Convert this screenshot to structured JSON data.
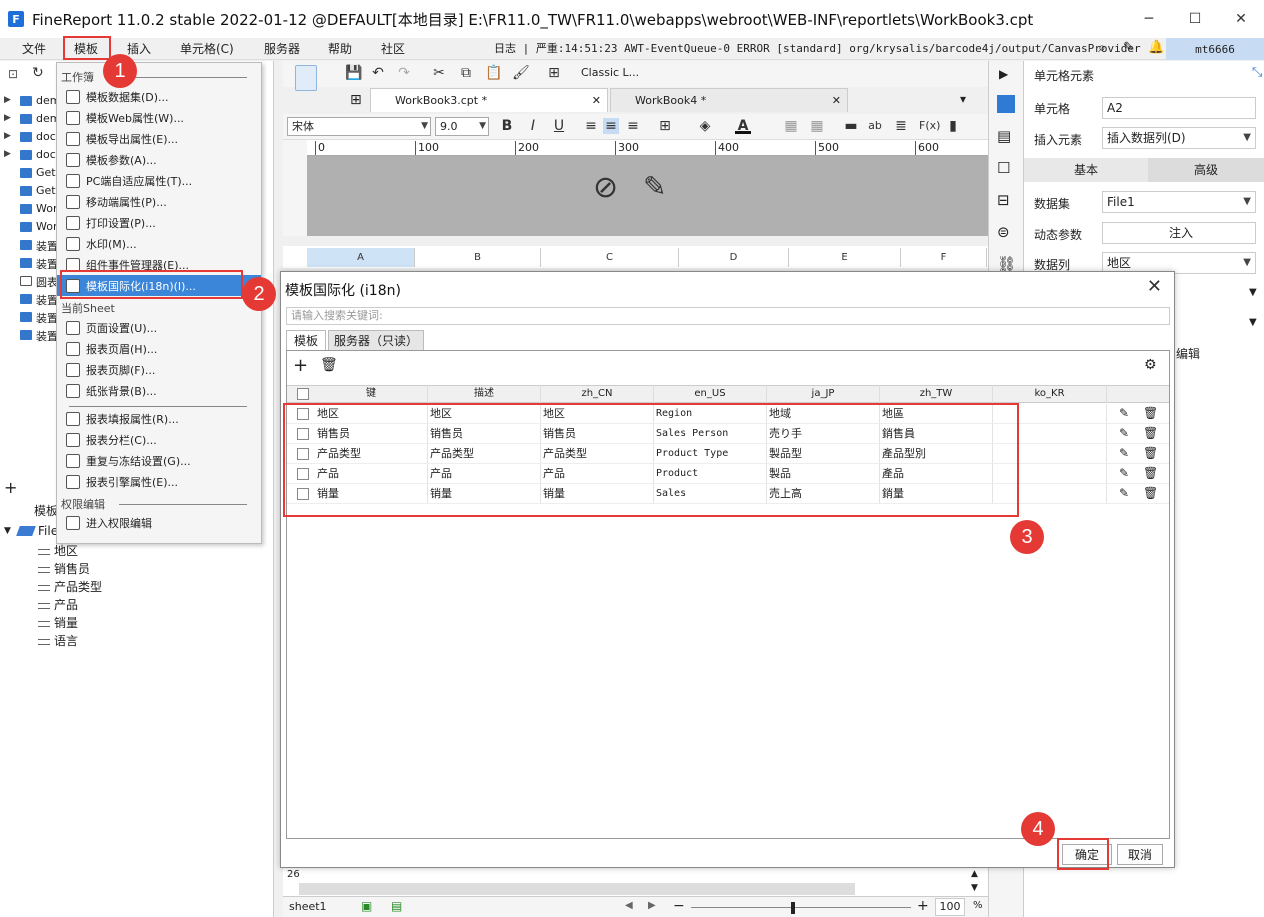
{
  "window": {
    "title": "FineReport 11.0.2 stable 2022-01-12 @DEFAULT[本地目录]    E:\\FR11.0_TW\\FR11.0\\webapps\\webroot\\WEB-INF\\reportlets\\WorkBook3.cpt"
  },
  "menubar": {
    "items": [
      "文件",
      "模板",
      "插入",
      "单元格(C)",
      "服务器",
      "帮助",
      "社区"
    ],
    "log": "日志 | 严重:14:51:23 AWT-EventQueue-0 ERROR [standard] org/krysalis/barcode4j/output/CanvasProvider",
    "user": "mt6666"
  },
  "left_tree": {
    "items": [
      "dem",
      "dem",
      "doc",
      "doc",
      "Get",
      "Get",
      "Wor",
      "Wor",
      "装置",
      "装置",
      "圆表",
      "装置",
      "装置",
      "装置"
    ]
  },
  "dataset_panel": {
    "tab_label": "模板",
    "dataset": "File1",
    "fields": [
      "地区",
      "销售员",
      "产品类型",
      "产品",
      "销量",
      "语言"
    ]
  },
  "template_menu": {
    "section_workbook": "工作簿",
    "section_sheet": "当前Sheet",
    "section_permission": "权限编辑",
    "items_workbook": [
      "模板数据集(D)...",
      "模板Web属性(W)...",
      "模板导出属性(E)...",
      "模板参数(A)...",
      "PC端自适应属性(T)...",
      "移动端属性(P)...",
      "打印设置(P)...",
      "水印(M)...",
      "组件事件管理器(E)...",
      "模板国际化(i18n)(I)..."
    ],
    "items_sheet": [
      "页面设置(U)...",
      "报表页眉(H)...",
      "报表页脚(F)...",
      "纸张背景(B)..."
    ],
    "items_sheet2": [
      "报表填报属性(R)...",
      "报表分栏(C)...",
      "重复与冻结设置(G)...",
      "报表引擎属性(E)..."
    ],
    "items_permission": [
      "进入权限编辑"
    ]
  },
  "toolbar": {
    "style_label": "Classic L..."
  },
  "tabs": [
    "WorkBook3.cpt *",
    "WorkBook4 *"
  ],
  "format": {
    "font": "宋体",
    "size": "9.0"
  },
  "ruler": [
    "0",
    "100",
    "200",
    "300",
    "400",
    "500",
    "600"
  ],
  "grid_columns": [
    "A",
    "B",
    "C",
    "D",
    "E",
    "F"
  ],
  "right_panel": {
    "title": "单元格元素",
    "cell_label": "单元格",
    "cell_value": "A2",
    "insert_label": "插入元素",
    "insert_value": "插入数据列(D)",
    "tab_basic": "基本",
    "tab_advanced": "高级",
    "dataset_label": "数据集",
    "dataset_value": "File1",
    "param_label": "动态参数",
    "param_value": "注入",
    "column_label": "数据列",
    "column_value": "地区",
    "partial": "编辑"
  },
  "dialog": {
    "title": "模板国际化 (i18n)",
    "search_placeholder": "请输入搜索关键词:",
    "tab_template": "模板",
    "tab_server": "服务器（只读）",
    "columns": [
      "键",
      "描述",
      "zh_CN",
      "en_US",
      "ja_JP",
      "zh_TW",
      "ko_KR"
    ],
    "rows": [
      [
        "地区",
        "地区",
        "地区",
        "Region",
        "地域",
        "地區",
        ""
      ],
      [
        "销售员",
        "销售员",
        "销售员",
        "Sales Person",
        "売り手",
        "銷售員",
        ""
      ],
      [
        "产品类型",
        "产品类型",
        "产品类型",
        "Product Type",
        "製品型",
        "產品型別",
        ""
      ],
      [
        "产品",
        "产品",
        "产品",
        "Product",
        "製品",
        "產品",
        ""
      ],
      [
        "销量",
        "销量",
        "销量",
        "Sales",
        "売上高",
        "銷量",
        ""
      ]
    ],
    "ok": "确定",
    "cancel": "取消"
  },
  "bottom": {
    "sheet": "sheet1",
    "row_num": "26",
    "zoom": "100",
    "percent": "%"
  },
  "annotations": [
    "1",
    "2",
    "3",
    "4"
  ]
}
